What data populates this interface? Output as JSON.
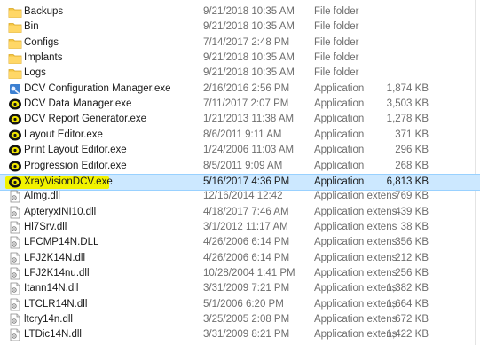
{
  "rows": [
    {
      "name": "Backups",
      "date": "9/21/2018 10:35 AM",
      "type": "File folder",
      "size": "",
      "icon": "folder-icon"
    },
    {
      "name": "Bin",
      "date": "9/21/2018 10:35 AM",
      "type": "File folder",
      "size": "",
      "icon": "folder-icon"
    },
    {
      "name": "Configs",
      "date": "7/14/2017 2:48 PM",
      "type": "File folder",
      "size": "",
      "icon": "folder-icon"
    },
    {
      "name": "Implants",
      "date": "9/21/2018 10:35 AM",
      "type": "File folder",
      "size": "",
      "icon": "folder-icon"
    },
    {
      "name": "Logs",
      "date": "9/21/2018 10:35 AM",
      "type": "File folder",
      "size": "",
      "icon": "folder-icon"
    },
    {
      "name": "DCV Configuration Manager.exe",
      "date": "2/16/2016 2:56 PM",
      "type": "Application",
      "size": "1,874 KB",
      "icon": "config-app-icon"
    },
    {
      "name": "DCV Data Manager.exe",
      "date": "7/11/2017 2:07 PM",
      "type": "Application",
      "size": "3,503 KB",
      "icon": "xray-app-icon"
    },
    {
      "name": "DCV Report Generator.exe",
      "date": "1/21/2013 11:38 AM",
      "type": "Application",
      "size": "1,278 KB",
      "icon": "xray-app-icon"
    },
    {
      "name": "Layout Editor.exe",
      "date": "8/6/2011 9:11 AM",
      "type": "Application",
      "size": "371 KB",
      "icon": "xray-app-icon"
    },
    {
      "name": "Print Layout Editor.exe",
      "date": "1/24/2006 11:03 AM",
      "type": "Application",
      "size": "296 KB",
      "icon": "xray-app-icon"
    },
    {
      "name": "Progression Editor.exe",
      "date": "8/5/2011 9:09 AM",
      "type": "Application",
      "size": "268 KB",
      "icon": "xray-app-icon"
    },
    {
      "name": "XrayVisionDCV.exe",
      "date": "5/16/2017 4:36 PM",
      "type": "Application",
      "size": "6,813 KB",
      "icon": "xray-app-icon",
      "selected": true
    },
    {
      "name": "Almg.dll",
      "date": "12/16/2014 12:42",
      "type": "Application extens",
      "size": "769 KB",
      "icon": "dll-file-icon"
    },
    {
      "name": "ApteryxINI10.dll",
      "date": "4/18/2017 7:46 AM",
      "type": "Application extens",
      "size": "439 KB",
      "icon": "dll-file-icon"
    },
    {
      "name": "Hl7Srv.dll",
      "date": "3/1/2012 11:17 AM",
      "type": "Application extens",
      "size": "38 KB",
      "icon": "dll-file-icon"
    },
    {
      "name": "LFCMP14N.DLL",
      "date": "4/26/2006 6:14 PM",
      "type": "Application extens",
      "size": "356 KB",
      "icon": "dll-file-icon"
    },
    {
      "name": "LFJ2K14N.dll",
      "date": "4/26/2006 6:14 PM",
      "type": "Application extens",
      "size": "212 KB",
      "icon": "dll-file-icon"
    },
    {
      "name": "LFJ2K14nu.dll",
      "date": "10/28/2004 1:41 PM",
      "type": "Application extens",
      "size": "256 KB",
      "icon": "dll-file-icon"
    },
    {
      "name": "Itann14N.dll",
      "date": "3/31/2009 7:21 PM",
      "type": "Application extens",
      "size": "1,382 KB",
      "icon": "dll-file-icon"
    },
    {
      "name": "LTCLR14N.dll",
      "date": "5/1/2006 6:20 PM",
      "type": "Application extens",
      "size": "1,664 KB",
      "icon": "dll-file-icon"
    },
    {
      "name": "ltcry14n.dll",
      "date": "3/25/2005 2:08 PM",
      "type": "Application extens",
      "size": "672 KB",
      "icon": "dll-file-icon"
    },
    {
      "name": "LTDic14N.dll",
      "date": "3/31/2009 8:21 PM",
      "type": "Application extens",
      "size": "1,422 KB",
      "icon": "dll-file-icon"
    }
  ],
  "colors": {
    "selection_bg": "#cce8ff",
    "highlight": "#f2f200",
    "folder": "#f4c542",
    "meta_text": "#6d6d6d"
  }
}
